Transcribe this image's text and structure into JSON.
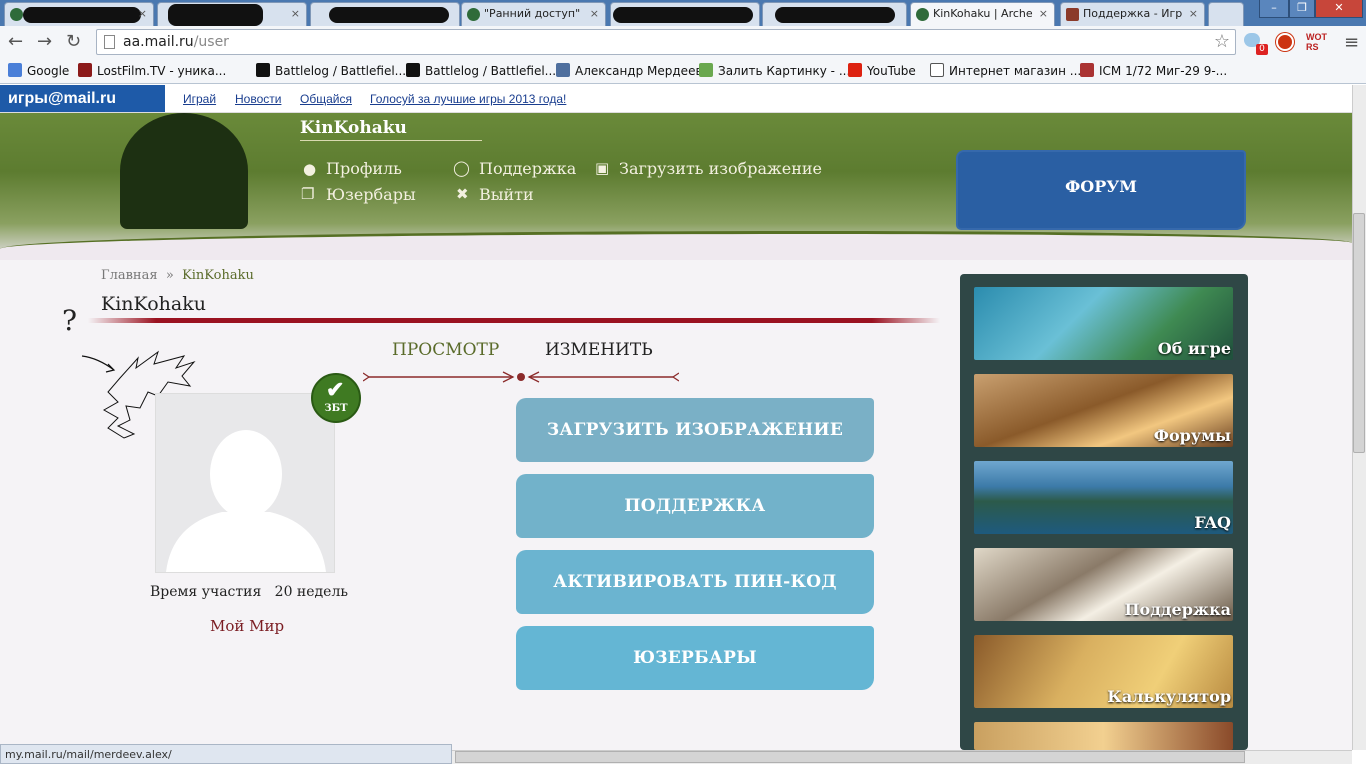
{
  "browser": {
    "tabs": [
      {
        "title": "",
        "redacted": true
      },
      {
        "title": "",
        "redacted": true
      },
      {
        "title": "",
        "redacted": true
      },
      {
        "title": "\"Ранний доступ\"",
        "redacted": false
      },
      {
        "title": "",
        "redacted": true
      },
      {
        "title": "",
        "redacted": true
      },
      {
        "title": "KinKohaku | Arche",
        "redacted": false
      },
      {
        "title": "Поддержка - Игр",
        "redacted": false
      }
    ],
    "tab_close": "×",
    "url_host": "aa.mail.ru",
    "url_path": "/user",
    "bookmarks": [
      "Google",
      "LostFilm.TV - уника...",
      "Battlelog / Battlefiel...",
      "Battlelog / Battlefiel...",
      "Александр Мердеев",
      "Залить Картинку - ...",
      "YouTube",
      "Интернет магазин ...",
      "ICM 1/72 Миг-29 9-..."
    ],
    "ext_badge": "0",
    "ext_wot": "WOT RS",
    "status_url": "my.mail.ru/mail/merdeev.alex/",
    "colors": {
      "frame": "#4a78b0",
      "toolbar": "#f4f6f9"
    }
  },
  "mailbar": {
    "logo": "игры@mail.ru",
    "links": [
      "Играй",
      "Новости",
      "Общайся",
      "Голосуй за лучшие игры 2013 года!"
    ]
  },
  "header": {
    "username": "KinKohaku",
    "menu": {
      "profile": "Профиль",
      "support": "Поддержка",
      "upload": "Загрузить изображение",
      "userbars": "Юзербары",
      "logout": "Выйти"
    },
    "forum_button": "ФОРУМ"
  },
  "breadcrumb": {
    "home": "Главная",
    "sep": "»",
    "current": "KinKohaku"
  },
  "page_title": "KinKohaku",
  "view_tabs": {
    "view": "ПРОСМОТР",
    "edit": "ИЗМЕНИТЬ"
  },
  "profile": {
    "badge": "ЗБТ",
    "since_label": "Время участия",
    "since_value": "20 недель",
    "my_world": "Мой Мир"
  },
  "actions": [
    "ЗАГРУЗИТЬ ИЗОБРАЖЕНИЕ",
    "ПОДДЕРЖКА",
    "АКТИВИРОВАТЬ ПИН-КОД",
    "ЮЗЕРБАРЫ"
  ],
  "sidebar": [
    "Об игре",
    "Форумы",
    "FAQ",
    "Поддержка",
    "Калькулятор"
  ],
  "annotation": "?"
}
